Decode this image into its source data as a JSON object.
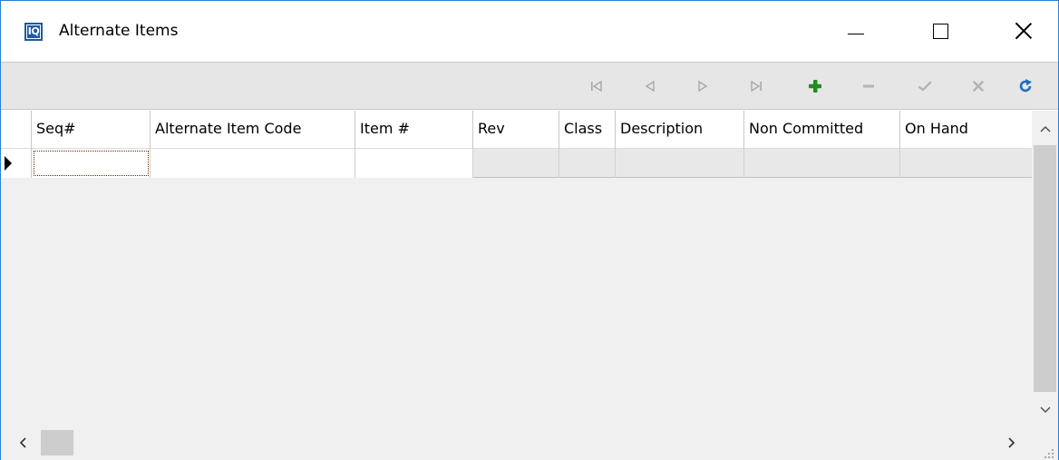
{
  "window": {
    "title": "Alternate Items",
    "app_icon_text": "IQ"
  },
  "toolbar": {
    "buttons": [
      {
        "name": "first-record",
        "icon": "first-record-icon",
        "enabled": false
      },
      {
        "name": "prior-record",
        "icon": "prior-record-icon",
        "enabled": false
      },
      {
        "name": "next-record",
        "icon": "next-record-icon",
        "enabled": false
      },
      {
        "name": "last-record",
        "icon": "last-record-icon",
        "enabled": false
      },
      {
        "name": "insert-record",
        "icon": "plus-icon",
        "enabled": true,
        "color": "#1e8c1e"
      },
      {
        "name": "delete-record",
        "icon": "minus-icon",
        "enabled": false
      },
      {
        "name": "post-edit",
        "icon": "checkmark-icon",
        "enabled": false
      },
      {
        "name": "cancel-edit",
        "icon": "x-icon",
        "enabled": false
      },
      {
        "name": "refresh-data",
        "icon": "refresh-icon",
        "enabled": true,
        "color": "#1f6fbf"
      }
    ]
  },
  "grid": {
    "columns": [
      "Seq#",
      "Alternate Item Code",
      "Item #",
      "Rev",
      "Class",
      "Description",
      "Non Committed",
      "On Hand"
    ],
    "rows": [
      {
        "current": true,
        "cells": [
          "",
          "",
          "",
          "",
          "",
          "",
          "",
          ""
        ]
      }
    ]
  },
  "colors": {
    "window_border": "#2b7fd4",
    "toolbar_bg": "#e6e6e6",
    "grid_bg": "#f0f0f0",
    "disabled_icon": "#a8a8a8"
  }
}
